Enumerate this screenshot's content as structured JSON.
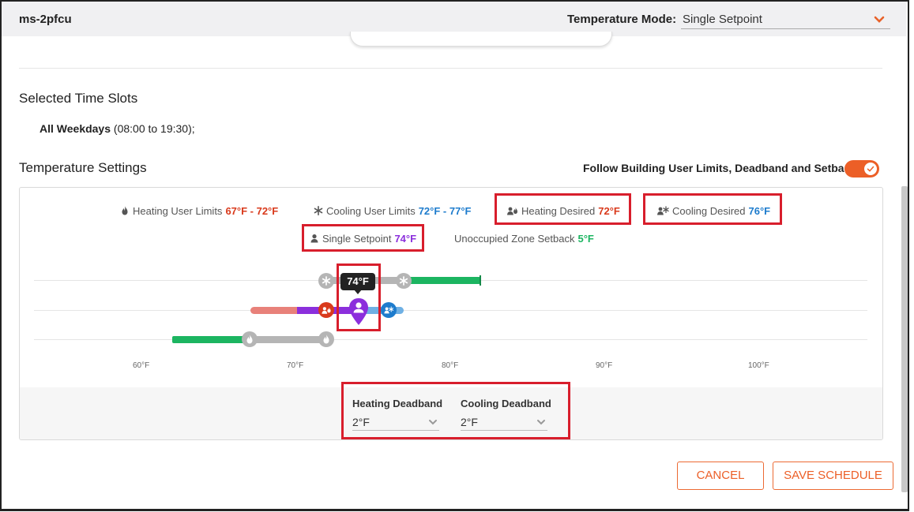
{
  "header": {
    "room_name": "ms-2pfcu",
    "temperature_mode_label": "Temperature Mode:",
    "temperature_mode_value": "Single Setpoint"
  },
  "time_slots": {
    "heading": "Selected Time Slots",
    "days": "All Weekdays",
    "range": "(08:00 to 19:30);"
  },
  "temperature_settings": {
    "heading": "Temperature Settings",
    "follow_limits_label": "Follow Building User Limits, Deadband and Setback",
    "follow_limits_enabled": true
  },
  "legend": {
    "heating_limits_label": "Heating User Limits",
    "heating_limits_value": "67°F - 72°F",
    "cooling_limits_label": "Cooling User Limits",
    "cooling_limits_value": "72°F - 77°F",
    "heating_desired_label": "Heating Desired",
    "heating_desired_value": "72°F",
    "cooling_desired_label": "Cooling Desired",
    "cooling_desired_value": "76°F",
    "single_setpoint_label": "Single Setpoint",
    "single_setpoint_value": "74°F",
    "setback_label": "Unoccupied Zone Setback",
    "setback_value": "5°F"
  },
  "slider": {
    "tooltip": "74°F",
    "ticks": [
      "60°F",
      "70°F",
      "80°F",
      "90°F",
      "100°F"
    ]
  },
  "deadband": {
    "heating_label": "Heating Deadband",
    "heating_value": "2°F",
    "cooling_label": "Cooling Deadband",
    "cooling_value": "2°F"
  },
  "buttons": {
    "cancel": "CANCEL",
    "save": "SAVE SCHEDULE"
  },
  "colors": {
    "accent": "#ec5f27",
    "heating": "#d93a1c",
    "cooling": "#1e7ccd",
    "setpoint": "#8b2fdc",
    "setback": "#1cb561",
    "highlight": "#d81e2c"
  },
  "icons": {
    "mode_dropdown": "chevron-down-icon",
    "heating_limits": "flame-icon",
    "cooling_limits": "snowflake-icon",
    "heating_desired": "person-flame-icon",
    "cooling_desired": "person-snowflake-icon",
    "single_setpoint": "person-icon",
    "toggle_check": "check-icon"
  }
}
